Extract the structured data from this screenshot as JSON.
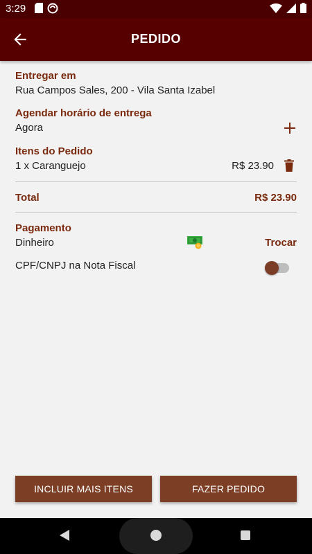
{
  "status_bar": {
    "time": "3:29"
  },
  "app_bar": {
    "title": "PEDIDO"
  },
  "delivery": {
    "label": "Entregar em",
    "address": "Rua Campos Sales, 200 - Vila Santa Izabel"
  },
  "schedule": {
    "label": "Agendar horário de entrega",
    "value": "Agora"
  },
  "items": {
    "label": "Itens do Pedido",
    "list": [
      {
        "description": "1 x Caranguejo",
        "price": "R$ 23.90"
      }
    ]
  },
  "total": {
    "label": "Total",
    "value": "R$ 23.90"
  },
  "payment": {
    "label": "Pagamento",
    "method": "Dinheiro",
    "change_label": "Trocar"
  },
  "cpf": {
    "label": "CPF/CNPJ na Nota Fiscal",
    "enabled": false
  },
  "buttons": {
    "add_more": "INCLUIR MAIS ITENS",
    "place_order": "FAZER PEDIDO"
  },
  "colors": {
    "app_bar": "#570000",
    "accent_text": "#7a2a0e",
    "button": "#7c3f26"
  }
}
